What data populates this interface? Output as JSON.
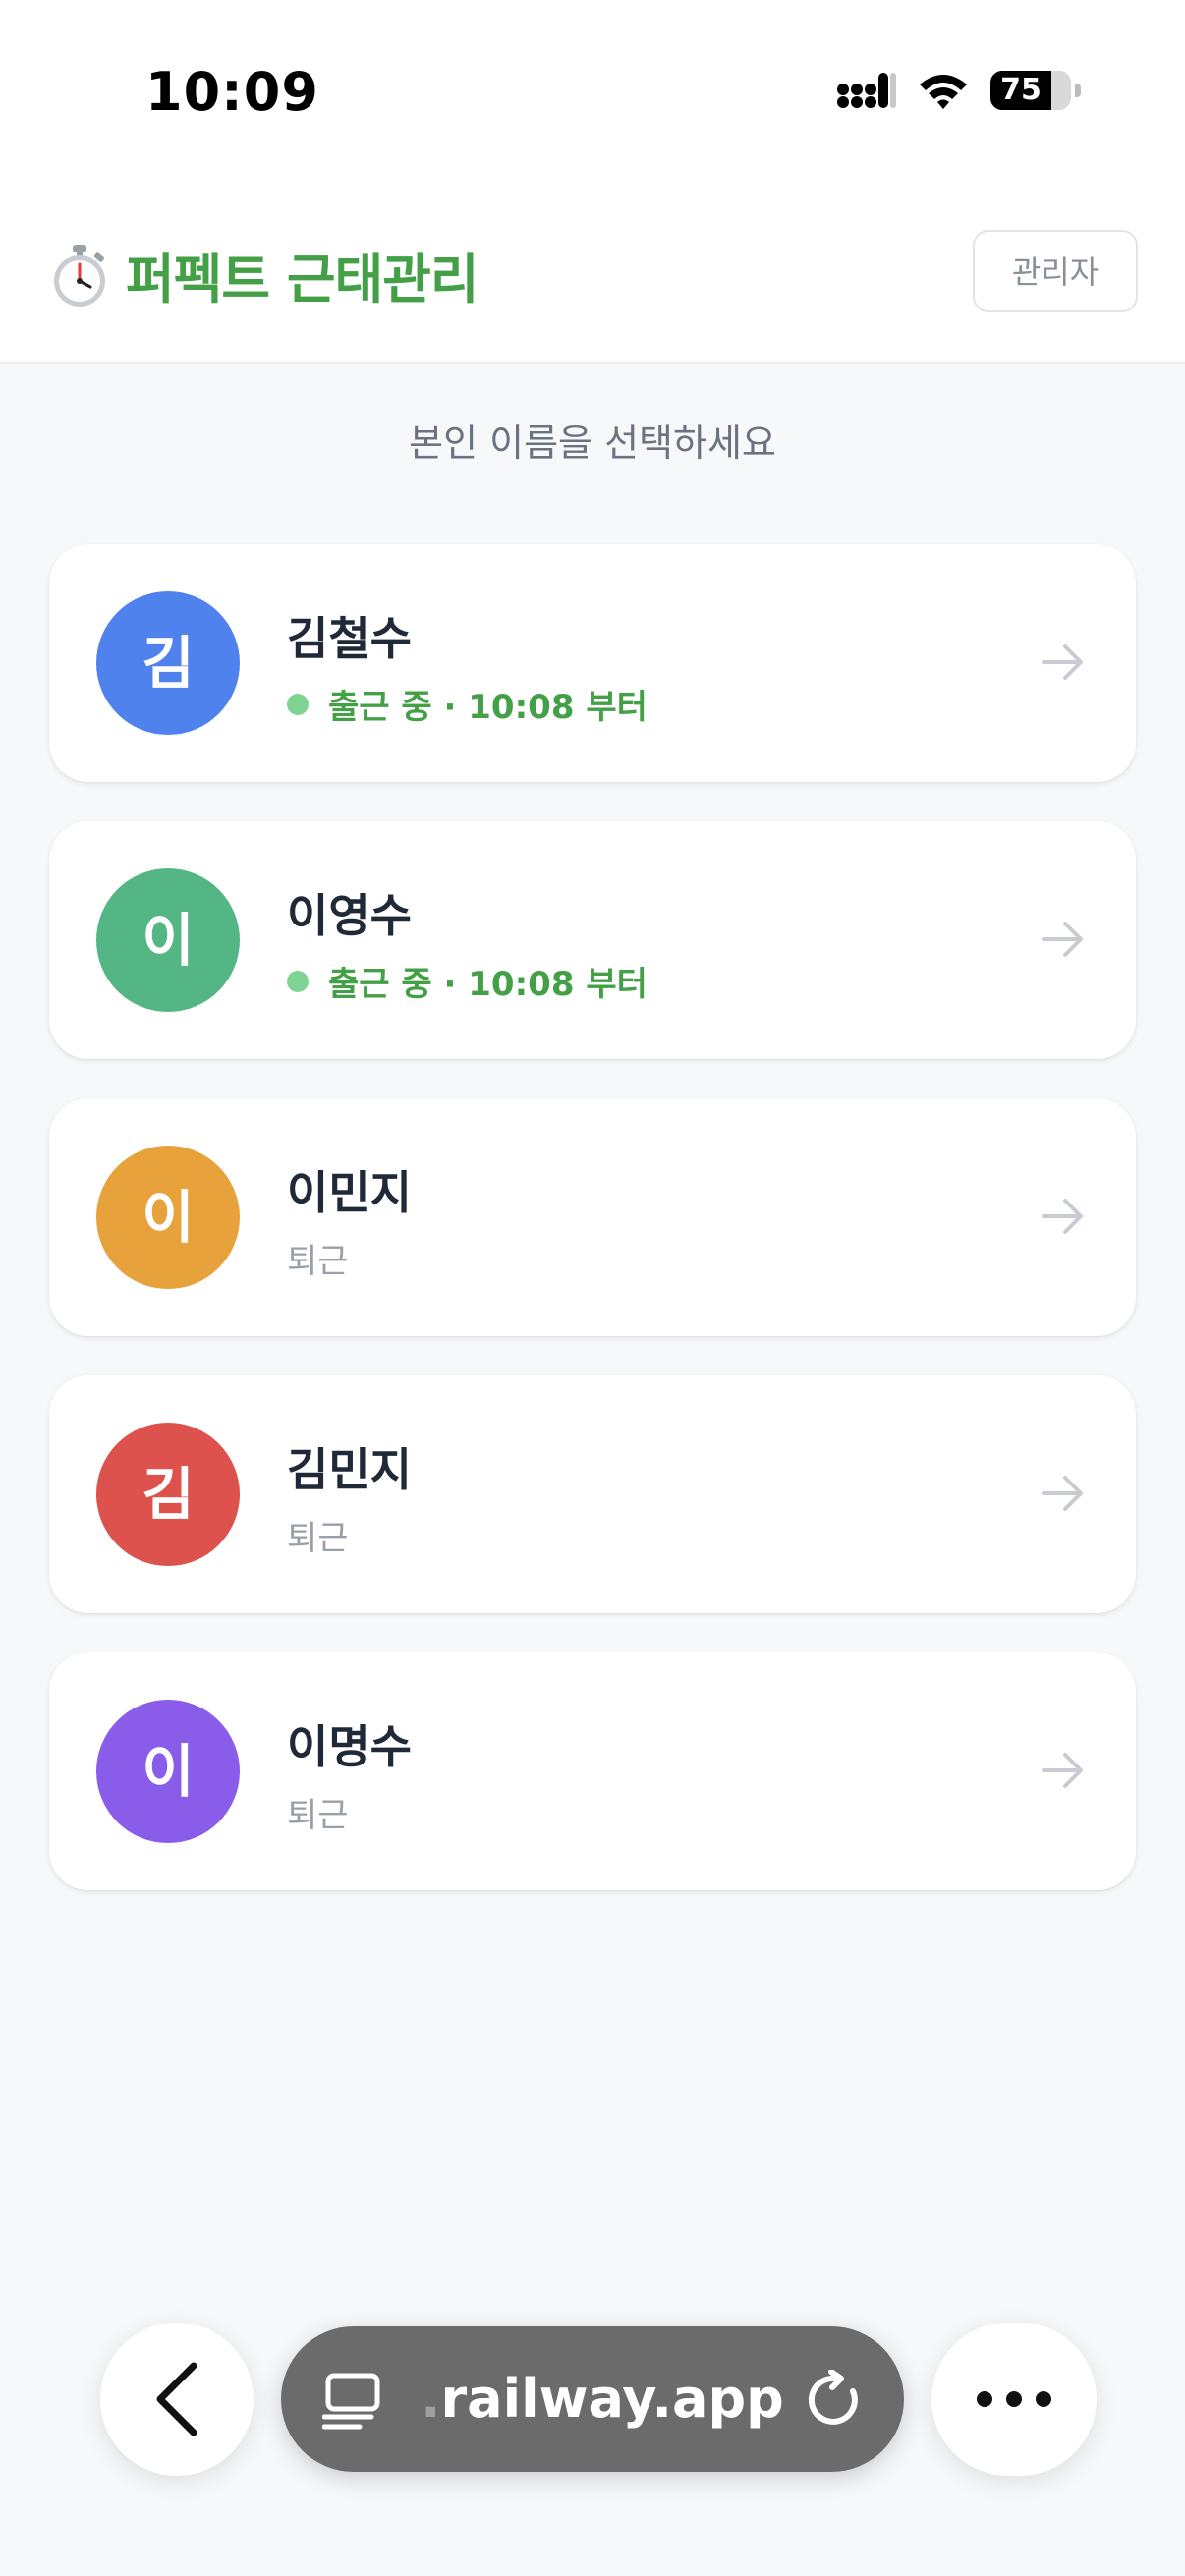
{
  "status_bar": {
    "time": "10:09",
    "battery": "75",
    "battery_level": 0.75
  },
  "header": {
    "icon": "stopwatch-icon",
    "title": "퍼펙트 근태관리",
    "admin_label": "관리자"
  },
  "subtitle": "본인 이름을 선택하세요",
  "employees": [
    {
      "initial": "김",
      "name": "김철수",
      "status": "출근 중 · 10:08 부터",
      "state": "active",
      "color": "#4f82ec"
    },
    {
      "initial": "이",
      "name": "이영수",
      "status": "출근 중 · 10:08 부터",
      "state": "active",
      "color": "#55b685"
    },
    {
      "initial": "이",
      "name": "이민지",
      "status": "퇴근",
      "state": "off",
      "color": "#e8a23b"
    },
    {
      "initial": "김",
      "name": "김민지",
      "status": "퇴근",
      "state": "off",
      "color": "#de524d"
    },
    {
      "initial": "이",
      "name": "이명수",
      "status": "퇴근",
      "state": "off",
      "color": "#895cea"
    }
  ],
  "browser": {
    "url": "railway.app",
    "url_prefix": "."
  }
}
